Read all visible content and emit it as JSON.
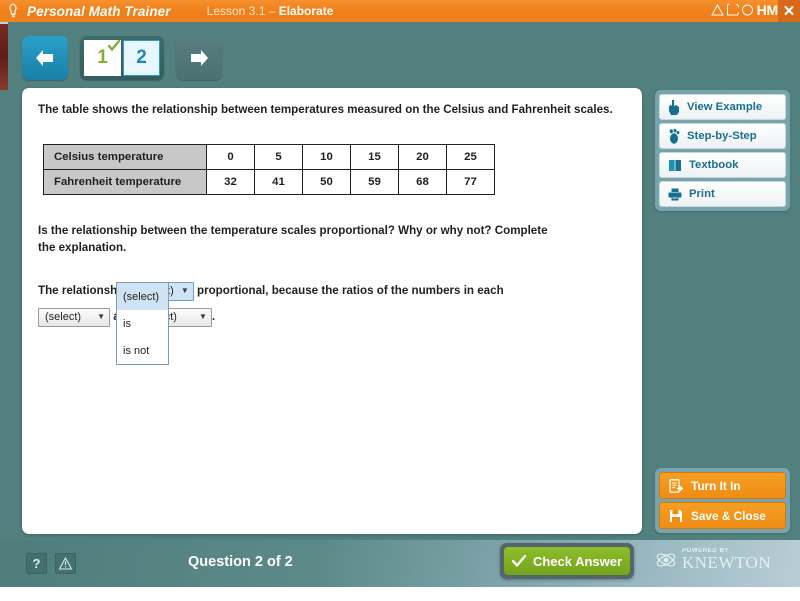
{
  "header": {
    "brand": "Personal Math Trainer",
    "brand_icon": "lightbulb-icon",
    "lesson_prefix": "Lesson 3.1 – ",
    "lesson_name": "Elaborate",
    "lesson_full": "Lesson 3.1 – Elaborate",
    "logo_word": "HM",
    "close_label": "✕",
    "accent_color": "#ef7f18"
  },
  "nav": {
    "back_label": "◀",
    "forward_label": "▶",
    "pages": [
      {
        "label": "1",
        "state": "completed"
      },
      {
        "label": "2",
        "state": "current"
      }
    ]
  },
  "content": {
    "intro": "The table shows the relationship between temperatures measured on the Celsius and Fahrenheit scales.",
    "table": {
      "rows": [
        {
          "header": "Celsius temperature",
          "values": [
            "0",
            "5",
            "10",
            "15",
            "20",
            "25"
          ]
        },
        {
          "header": "Fahrenheit temperature",
          "values": [
            "32",
            "41",
            "50",
            "59",
            "68",
            "77"
          ]
        }
      ]
    },
    "question": "Is the relationship between the temperature scales proportional? Why or why not? Complete the explanation.",
    "sentence": {
      "part1": "The relationship",
      "part2": "proportional, because the ratios of the numbers in each",
      "part3": "are",
      "part4": "."
    },
    "selects": {
      "select1": {
        "value": "(select)",
        "state": "open"
      },
      "select2": {
        "value": "(select)",
        "state": "closed"
      },
      "select3": {
        "value": "(select)",
        "state": "closed"
      }
    },
    "dropdown": {
      "options": [
        {
          "label": "(select)",
          "selected": true
        },
        {
          "label": "is",
          "selected": false
        },
        {
          "label": "is not",
          "selected": false
        }
      ]
    }
  },
  "tools": [
    {
      "label": "View Example",
      "icon": "pointing-hand-icon"
    },
    {
      "label": "Step-by-Step",
      "icon": "footprint-icon"
    },
    {
      "label": "Textbook",
      "icon": "book-icon"
    },
    {
      "label": "Print",
      "icon": "printer-icon"
    }
  ],
  "actions": [
    {
      "label": "Turn It In",
      "icon": "turn-in-icon"
    },
    {
      "label": "Save & Close",
      "icon": "floppy-disk-icon"
    }
  ],
  "footer": {
    "help_label": "?",
    "alert_label": "!",
    "question_counter": "Question 2 of 2",
    "check_answer": "Check Answer",
    "check_icon": "checkmark-icon",
    "check_color": "#7fb11f",
    "powered_by": "POWERED BY",
    "knewton": "KNEWTON"
  }
}
